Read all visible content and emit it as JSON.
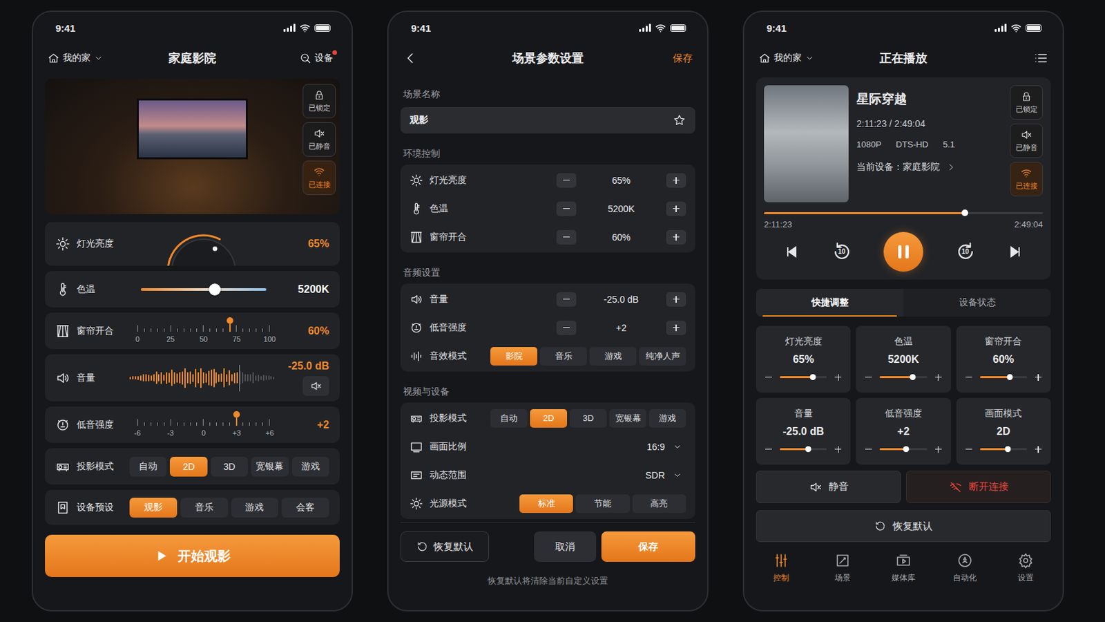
{
  "home": {
    "time": "9:41",
    "home_label": "我的家",
    "title": "家庭影院",
    "device_button": {
      "label": "设备",
      "has_alert": true
    },
    "hero_toggles": [
      {
        "label": "已锁定",
        "kind": "lock",
        "active": false
      },
      {
        "label": "已静音",
        "kind": "mute",
        "active": false
      },
      {
        "label": "已连接",
        "kind": "wifi",
        "active": true
      }
    ],
    "controls": [
      {
        "kind": "dial",
        "label": "灯光亮度",
        "value": "65%",
        "level": 0.65
      },
      {
        "kind": "slider",
        "label": "色温",
        "value": "5200K",
        "level": 0.59
      },
      {
        "kind": "ruler",
        "label": "窗帘开合",
        "value": "60%",
        "level": 0.7,
        "ticks": [
          "0",
          "25",
          "50",
          "75",
          "100"
        ]
      },
      {
        "kind": "wave",
        "label": "音量",
        "value": "-25.0 dB",
        "level": 0.74,
        "muted": false
      },
      {
        "kind": "ruler",
        "label": "低音强度",
        "value": "+2",
        "level": 0.75,
        "ticks": [
          "-6",
          "-3",
          "0",
          "+3",
          "+6"
        ]
      },
      {
        "kind": "segment",
        "label": "投影模式",
        "options": [
          {
            "label": "自动",
            "selected": false
          },
          {
            "label": "2D",
            "selected": true
          },
          {
            "label": "3D",
            "selected": false
          },
          {
            "label": "宽银幕",
            "selected": false
          },
          {
            "label": "游戏",
            "selected": false
          }
        ]
      },
      {
        "kind": "segment",
        "label": "设备预设",
        "options": [
          {
            "label": "观影",
            "selected": true
          },
          {
            "label": "音乐",
            "selected": false
          },
          {
            "label": "游戏",
            "selected": false
          },
          {
            "label": "会客",
            "selected": false
          }
        ]
      }
    ],
    "start_button": "开始观影"
  },
  "settings": {
    "time": "9:41",
    "title": "场景参数设置",
    "save_link": "保存",
    "name_section": "场景名称",
    "scene_name": "观影",
    "favorite": false,
    "sections": [
      {
        "title": "环境控制",
        "rows": [
          {
            "kind": "stepper",
            "label": "灯光亮度",
            "value": "65%"
          },
          {
            "kind": "stepper",
            "label": "色温",
            "value": "5200K"
          },
          {
            "kind": "stepper",
            "label": "窗帘开合",
            "value": "60%"
          }
        ]
      },
      {
        "title": "音频设置",
        "rows": [
          {
            "kind": "stepper",
            "label": "音量",
            "value": "-25.0 dB"
          },
          {
            "kind": "stepper",
            "label": "低音强度",
            "value": "+2"
          },
          {
            "kind": "segment",
            "label": "音效模式",
            "options": [
              {
                "label": "影院",
                "selected": true
              },
              {
                "label": "音乐",
                "selected": false
              },
              {
                "label": "游戏",
                "selected": false
              },
              {
                "label": "纯净人声",
                "selected": false
              }
            ]
          }
        ]
      },
      {
        "title": "视频与设备",
        "rows": [
          {
            "kind": "segment",
            "label": "投影模式",
            "options": [
              {
                "label": "自动",
                "selected": false
              },
              {
                "label": "2D",
                "selected": true
              },
              {
                "label": "3D",
                "selected": false
              },
              {
                "label": "宽银幕",
                "selected": false
              },
              {
                "label": "游戏",
                "selected": false
              }
            ]
          },
          {
            "kind": "select",
            "label": "画面比例",
            "value": "16:9"
          },
          {
            "kind": "select",
            "label": "动态范围",
            "value": "SDR"
          },
          {
            "kind": "segment",
            "label": "光源模式",
            "options": [
              {
                "label": "标准",
                "selected": true
              },
              {
                "label": "节能",
                "selected": false
              },
              {
                "label": "高亮",
                "selected": false
              }
            ]
          }
        ]
      }
    ],
    "footer": {
      "reset": "恢复默认",
      "cancel": "取消",
      "save": "保存",
      "note": "恢复默认将清除当前自定义设置"
    }
  },
  "player": {
    "time": "9:41",
    "home_label": "我的家",
    "title": "正在播放",
    "media": {
      "title": "星际穿越",
      "time": "2:11:23 / 2:49:04",
      "formats": [
        "1080P",
        "DTS-HD",
        "5.1"
      ],
      "device": "当前设备：家庭影院"
    },
    "toggles": [
      {
        "label": "已锁定",
        "kind": "lock",
        "active": false
      },
      {
        "label": "已静音",
        "kind": "mute",
        "active": false
      },
      {
        "label": "已连接",
        "kind": "wifi",
        "active": true
      }
    ],
    "progress": {
      "level": 0.72,
      "elapsed": "2:11:23",
      "total": "2:49:04"
    },
    "skip_seconds": "10",
    "playing": true,
    "tabs": [
      {
        "label": "快捷调整",
        "selected": true
      },
      {
        "label": "设备状态",
        "selected": false
      }
    ],
    "tiles": [
      {
        "label": "灯光亮度",
        "value": "65%",
        "level": 0.7
      },
      {
        "label": "色温",
        "value": "5200K",
        "level": 0.7
      },
      {
        "label": "窗帘开合",
        "value": "60%",
        "level": 0.63
      },
      {
        "label": "音量",
        "value": "-25.0 dB",
        "level": 0.6
      },
      {
        "label": "低音强度",
        "value": "+2",
        "level": 0.55
      },
      {
        "label": "画面模式",
        "value": "2D",
        "level": 0.6
      }
    ],
    "mute_button": "静音",
    "disconnect_button": "断开连接",
    "reset_button": "恢复默认",
    "nav": [
      {
        "label": "控制",
        "selected": true
      },
      {
        "label": "场景",
        "selected": false
      },
      {
        "label": "媒体库",
        "selected": false
      },
      {
        "label": "自动化",
        "selected": false
      },
      {
        "label": "设置",
        "selected": false
      }
    ]
  }
}
